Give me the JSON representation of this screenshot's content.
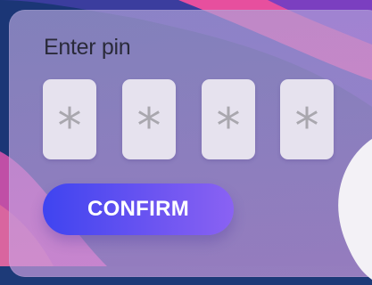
{
  "pin_prompt": {
    "title": "Enter pin",
    "digits": [
      "*",
      "*",
      "*",
      "*"
    ]
  },
  "actions": {
    "confirm_label": "CONFIRM"
  },
  "colors": {
    "panel": "#b8a6df",
    "pin_box": "#e6e2ee",
    "button_start": "#3f44f0",
    "button_end": "#8a62f3",
    "title_text": "#2a2a3a"
  }
}
